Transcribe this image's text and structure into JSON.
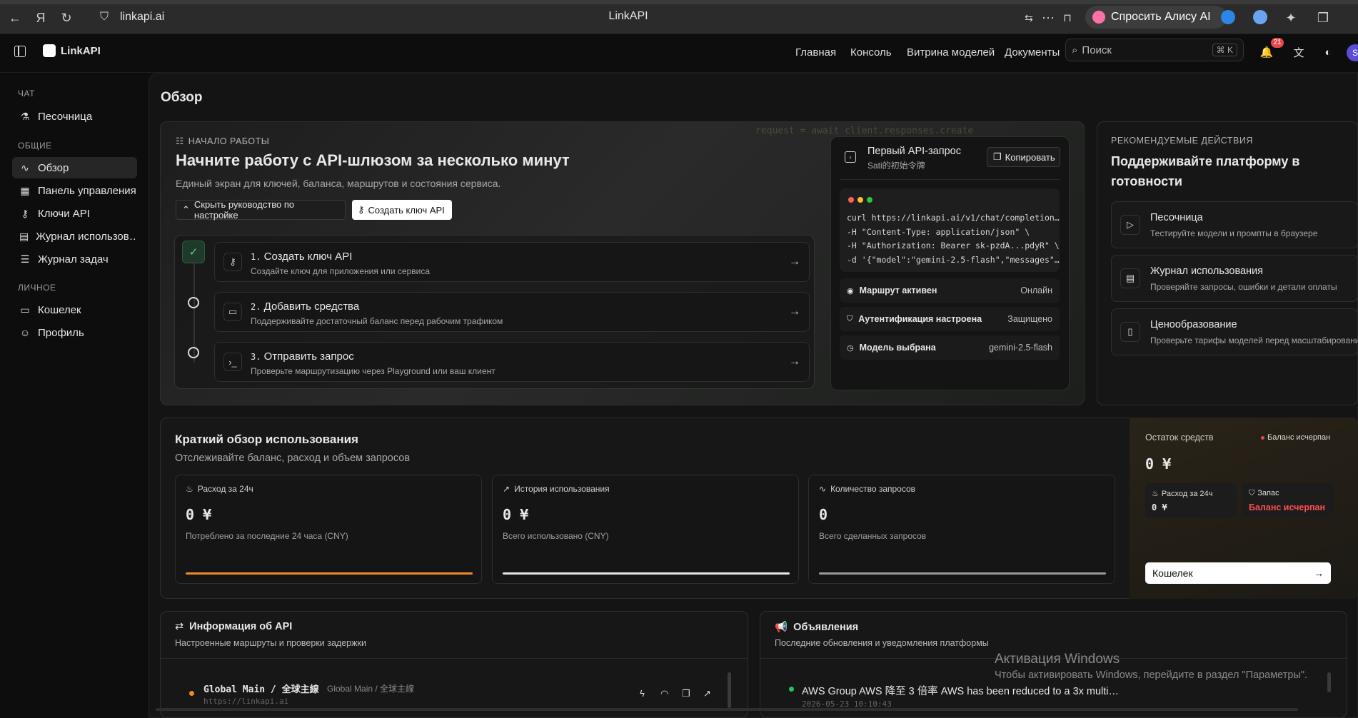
{
  "browser": {
    "url": "linkapi.ai",
    "tab_title": "LinkAPI",
    "alice_label": "Спросить Алису AI"
  },
  "header": {
    "brand": "LinkAPI",
    "nav": [
      "Главная",
      "Консоль",
      "Витрина моделей",
      "Документы"
    ],
    "search_placeholder": "Поиск",
    "search_shortcut": "⌘ K",
    "notifications_count": "21",
    "avatar_letter": "S"
  },
  "sidebar": {
    "sections": [
      {
        "title": "ЧАТ",
        "items": [
          {
            "label": "Песочница",
            "icon": "flask-icon"
          }
        ]
      },
      {
        "title": "ОБЩИЕ",
        "items": [
          {
            "label": "Обзор",
            "icon": "activity-icon",
            "active": true
          },
          {
            "label": "Панель управления",
            "icon": "grid-icon"
          },
          {
            "label": "Ключи API",
            "icon": "key-icon"
          },
          {
            "label": "Журнал использов…",
            "icon": "file-icon"
          },
          {
            "label": "Журнал задач",
            "icon": "list-icon"
          }
        ]
      },
      {
        "title": "ЛИЧНОЕ",
        "items": [
          {
            "label": "Кошелек",
            "icon": "wallet-icon"
          },
          {
            "label": "Профиль",
            "icon": "user-icon"
          }
        ]
      }
    ]
  },
  "page": {
    "title": "Обзор"
  },
  "hero": {
    "eyebrow": "НАЧАЛО РАБОТЫ",
    "title": "Начните работу с API-шлюзом за несколько минут",
    "subtitle": "Единый экран для ключей, баланса, маршрутов и состояния сервиса.",
    "hide_guide_label": "Скрыть руководство по настройке",
    "create_key_label": "Создать ключ API",
    "bg_code": "request = await client.responses.create",
    "steps": [
      {
        "num": "1.",
        "title": "Создать ключ API",
        "desc": "Создайте ключ для приложения или сервиса",
        "done": true
      },
      {
        "num": "2.",
        "title": "Добавить средства",
        "desc": "Поддерживайте достаточный баланс перед рабочим трафиком",
        "done": false
      },
      {
        "num": "3.",
        "title": "Отправить запрос",
        "desc": "Проверьте маршрутизацию через Playground или ваш клиент",
        "done": false
      }
    ]
  },
  "first_request": {
    "title": "Первый API-запрос",
    "subtitle": "Sati的初始令牌",
    "copy_label": "Копировать",
    "code": [
      "curl https://linkapi.ai/v1/chat/completion…",
      "-H \"Content-Type: application/json\" \\",
      "-H \"Authorization: Bearer sk-pzdA...pdyR\" \\",
      "-d '{\"model\":\"gemini-2.5-flash\",\"messages\"…"
    ],
    "status": [
      {
        "label": "Маршрут активен",
        "value": "Онлайн",
        "icon": "radio-icon"
      },
      {
        "label": "Аутентификация настроена",
        "value": "Защищено",
        "icon": "shield-icon"
      },
      {
        "label": "Модель выбрана",
        "value": "gemini-2.5-flash",
        "icon": "timer-icon"
      }
    ]
  },
  "recommended": {
    "eyebrow": "РЕКОМЕНДУЕМЫЕ ДЕЙСТВИЯ",
    "title": "Поддерживайте платформу в готовности",
    "items": [
      {
        "title": "Песочница",
        "desc": "Тестируйте модели и промпты в браузере",
        "icon": "play-icon"
      },
      {
        "title": "Журнал использования",
        "desc": "Проверяйте запросы, ошибки и детали оплаты",
        "icon": "file-icon"
      },
      {
        "title": "Ценообразование",
        "desc": "Проверьте тарифы моделей перед масштабированием",
        "icon": "book-icon"
      }
    ]
  },
  "usage": {
    "title": "Краткий обзор использования",
    "subtitle": "Отслеживайте баланс, расход и объем запросов",
    "stats": [
      {
        "label": "Расход за 24ч",
        "value": "0 ¥",
        "desc": "Потреблено за последние 24 часа (CNY)",
        "icon": "flame-icon",
        "bar_color": "#f08a24"
      },
      {
        "label": "История использования",
        "value": "0 ¥",
        "desc": "Всего использовано (CNY)",
        "icon": "trend-icon",
        "bar_color": "#e6e6e6"
      },
      {
        "label": "Количество запросов",
        "value": "0",
        "desc": "Всего сделанных запросов",
        "icon": "pulse-icon",
        "bar_color": "#9a9a9a"
      }
    ]
  },
  "balance": {
    "label": "Остаток средств",
    "status": "Баланс исчерпан",
    "value": "0 ¥",
    "spend_label": "Расход за 24ч",
    "spend_value": "0 ¥",
    "reserve_label": "Запас",
    "reserve_value": "Баланс исчерпан",
    "wallet_label": "Кошелек"
  },
  "api_info": {
    "title": "Информация об API",
    "subtitle": "Настроенные маршруты и проверки задержки",
    "route_name": "Global Main / 全球主線",
    "route_tag": "Global Main / 全球主線",
    "route_url": "https://linkapi.ai"
  },
  "announcements": {
    "title": "Объявления",
    "subtitle": "Последние обновления и уведомления платформы",
    "item_text": "AWS Group AWS 降至 3 倍率 AWS has been reduced to a 3x multi…",
    "item_date": "2026-05-23 10:10:43"
  },
  "watermark": {
    "title": "Активация Windows",
    "text": "Чтобы активировать Windows, перейдите в раздел \"Параметры\"."
  },
  "colors": {
    "accent_orange": "#f08a24",
    "danger": "#e5484d",
    "success": "#22c55e"
  }
}
